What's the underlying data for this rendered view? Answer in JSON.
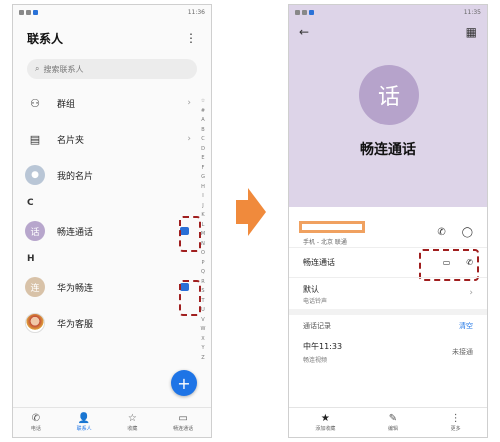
{
  "left": {
    "status_time": "11:36",
    "title": "联系人",
    "search_placeholder": "搜索联系人",
    "rows": [
      {
        "label": "群组"
      },
      {
        "label": "名片夹"
      },
      {
        "label": "我的名片"
      }
    ],
    "section_c": "C",
    "contact_c": {
      "avatar": "话",
      "name": "畅连通话"
    },
    "section_h": "H",
    "contact_h1": {
      "avatar": "连",
      "name": "华为畅连"
    },
    "contact_h2": {
      "name": "华为客服"
    },
    "alphabet": [
      "☆",
      "#",
      "A",
      "B",
      "C",
      "D",
      "E",
      "F",
      "G",
      "H",
      "I",
      "J",
      "K",
      "L",
      "M",
      "N",
      "O",
      "P",
      "Q",
      "R",
      "S",
      "T",
      "U",
      "V",
      "W",
      "X",
      "Y",
      "Z"
    ],
    "fab": "+",
    "nav": [
      {
        "icon": "phone-icon",
        "label": "电话"
      },
      {
        "icon": "contacts-icon",
        "label": "联系人"
      },
      {
        "icon": "star-icon",
        "label": "收藏"
      },
      {
        "icon": "video-icon",
        "label": "畅连通话"
      }
    ]
  },
  "right": {
    "status_time": "11:35",
    "avatar": "话",
    "name": "畅连通话",
    "phone_sub": "手机 - 北京 联通",
    "meetime_label": "畅连通话",
    "ringtone_title": "默认",
    "ringtone_sub": "电话铃声",
    "records_label": "通话记录",
    "clear_label": "清空",
    "record_time": "中午11:33",
    "record_sub": "畅连视频",
    "record_status": "未接通",
    "nav": [
      {
        "icon": "star-icon",
        "label": "添加收藏"
      },
      {
        "icon": "pencil-icon",
        "label": "编辑"
      },
      {
        "icon": "more-icon",
        "label": "更多"
      }
    ]
  },
  "colors": {
    "accent": "#1e74e6",
    "highlight": "#a01f1f",
    "arrow": "#f08a3c",
    "header": "#ddd4e8"
  }
}
